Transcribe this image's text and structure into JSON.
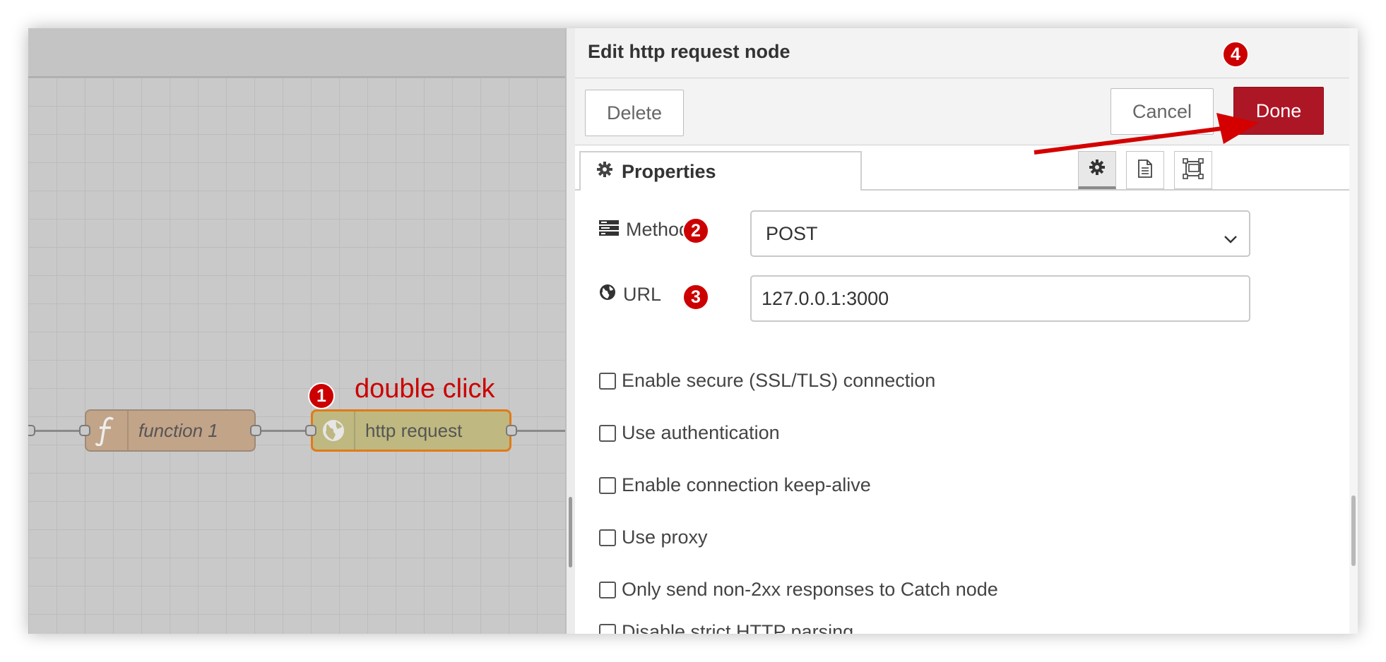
{
  "canvas": {
    "nodes": [
      {
        "label": "function 1",
        "icon": "function-icon"
      },
      {
        "label": "http request",
        "icon": "globe-icon"
      }
    ]
  },
  "annotations": {
    "step1": "1",
    "step1_text": "double click",
    "step2": "2",
    "step3": "3",
    "step4": "4",
    "color": "#cc0000"
  },
  "tray": {
    "title": "Edit http request node",
    "delete_label": "Delete",
    "cancel_label": "Cancel",
    "done_label": "Done",
    "tab_label": "Properties",
    "tab_icon": "gear-icon",
    "tab_tools": [
      "gear-icon",
      "description-icon",
      "appearance-icon"
    ]
  },
  "form": {
    "method_label": "Method",
    "method_value": "POST",
    "url_label": "URL",
    "url_value": "127.0.0.1:3000",
    "checkboxes": [
      {
        "label": "Enable secure (SSL/TLS) connection",
        "checked": false
      },
      {
        "label": "Use authentication",
        "checked": false
      },
      {
        "label": "Enable connection keep-alive",
        "checked": false
      },
      {
        "label": "Use proxy",
        "checked": false
      },
      {
        "label": "Only send non-2xx responses to Catch node",
        "checked": false
      },
      {
        "label": "Disable strict HTTP parsing",
        "checked": false
      }
    ]
  },
  "colors": {
    "done_button": "#ad1625",
    "http_node_border": "#e07a1a"
  }
}
